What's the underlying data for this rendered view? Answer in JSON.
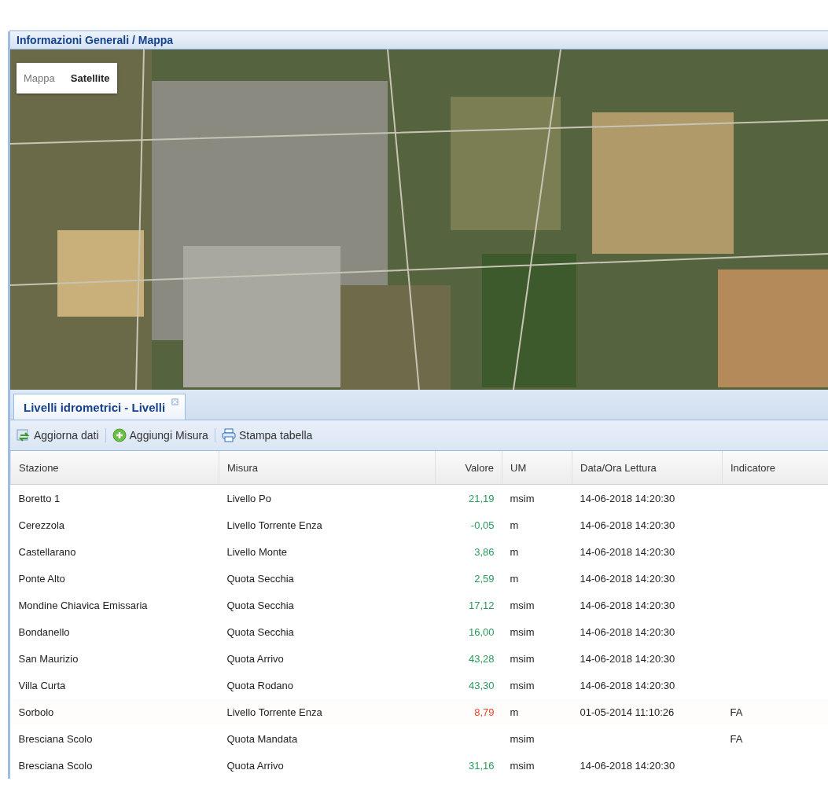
{
  "map_panel": {
    "title": "Informazioni Generali / Mappa",
    "map_type_buttons": [
      {
        "label": "Mappa",
        "selected": false
      },
      {
        "label": "Satellite",
        "selected": true
      }
    ]
  },
  "tabs": [
    {
      "label": "Livelli idrometrici - Livelli",
      "selected": true,
      "closable": true
    }
  ],
  "toolbar": [
    {
      "label": "Aggiorna dati",
      "kind": "refresh"
    },
    {
      "label": "Aggiungi Misura",
      "kind": "add"
    },
    {
      "label": "Stampa tabella",
      "kind": "print"
    }
  ],
  "table": {
    "columns": [
      "Stazione",
      "Misura",
      "Valore",
      "UM",
      "Data/Ora Lettura",
      "Indicatore"
    ],
    "rows": [
      {
        "stazione": "Boretto 1",
        "misura": "Livello Po",
        "valore": "21,19",
        "alarm": false,
        "um": "msim",
        "data": "14-06-2018 14:20:30"
      },
      {
        "stazione": "Cerezzola",
        "misura": "Livello Torrente Enza",
        "valore": "-0,05",
        "alarm": false,
        "um": "m",
        "data": "14-06-2018 14:20:30"
      },
      {
        "stazione": "Castellarano",
        "misura": "Livello Monte",
        "valore": "3,86",
        "alarm": false,
        "um": "m",
        "data": "14-06-2018 14:20:30"
      },
      {
        "stazione": "Ponte Alto",
        "misura": "Quota Secchia",
        "valore": "2,59",
        "alarm": false,
        "um": "m",
        "data": "14-06-2018 14:20:30"
      },
      {
        "stazione": "Mondine Chiavica Emissaria",
        "misura": "Quota Secchia",
        "valore": "17,12",
        "alarm": false,
        "um": "msim",
        "data": "14-06-2018 14:20:30"
      },
      {
        "stazione": "Bondanello",
        "misura": "Quota Secchia",
        "valore": "16,00",
        "alarm": false,
        "um": "msim",
        "data": "14-06-2018 14:20:30"
      },
      {
        "stazione": "San Maurizio",
        "misura": "Quota Arrivo",
        "valore": "43,28",
        "alarm": false,
        "um": "msim",
        "data": "14-06-2018 14:20:30"
      },
      {
        "stazione": "Villa Curta",
        "misura": "Quota Rodano",
        "valore": "43,30",
        "alarm": false,
        "um": "msim",
        "data": "14-06-2018 14:20:30"
      },
      {
        "stazione": "Sorbolo",
        "misura": "Livello Torrente Enza",
        "valore": "8,79",
        "alarm": true,
        "um": "m",
        "data": "01-05-2014 11:10:26",
        "indicatore": "FA"
      },
      {
        "stazione": "Bresciana Scolo",
        "misura": "Quota Mandata",
        "um": "msim",
        "indicatore": "FA"
      },
      {
        "stazione": "Bresciana Scolo",
        "misura": "Quota Arrivo",
        "valore": "31,16",
        "alarm": false,
        "um": "msim",
        "data": "14-06-2018 14:20:30"
      }
    ]
  }
}
